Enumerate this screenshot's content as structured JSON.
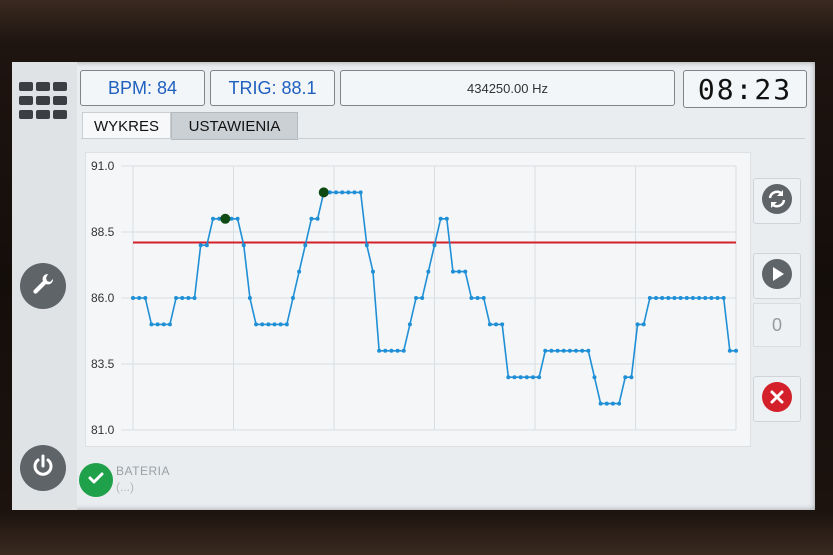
{
  "header": {
    "bpm": "BPM: 84",
    "trig": "TRIG: 88.1",
    "frequency": "434250.00 Hz",
    "time": "08:23"
  },
  "tabs": [
    {
      "label": "WYKRES",
      "active": true
    },
    {
      "label": "USTAWIENIA",
      "active": false
    }
  ],
  "right_panel": {
    "counter": "0"
  },
  "status": {
    "battery_label": "BATERIA",
    "battery_value": "(...)"
  },
  "icons": {
    "menu": "grid-menu-icon",
    "settings": "wrench-icon",
    "power": "power-icon",
    "refresh": "refresh-icon",
    "play": "play-icon",
    "close": "close-icon",
    "battery_ok": "check-icon"
  },
  "colors": {
    "line": "#1f8fd6",
    "trigger": "#d3202a",
    "peak_marker": "#0e4a12",
    "accent_text": "#1f5fbf",
    "ok": "#1fa04a",
    "close": "#d3202a"
  },
  "chart_data": {
    "type": "line",
    "ylim": [
      81.0,
      91.0
    ],
    "yticks": [
      "91.0",
      "88.5",
      "86.0",
      "83.5",
      "81.0"
    ],
    "grid": true,
    "threshold": 88.1,
    "x": [
      0,
      1,
      2,
      3,
      4,
      5,
      6,
      7,
      8,
      9,
      10,
      11,
      12,
      13,
      14,
      15,
      16,
      17,
      18,
      19,
      20,
      21,
      22,
      23,
      24,
      25,
      26,
      27,
      28,
      29,
      30,
      31,
      32,
      33,
      34,
      35,
      36,
      37,
      38,
      39,
      40,
      41,
      42,
      43,
      44,
      45,
      46,
      47,
      48,
      49,
      50,
      51,
      52,
      53,
      54,
      55,
      56,
      57,
      58,
      59,
      60,
      61,
      62,
      63,
      64,
      65,
      66,
      67,
      68,
      69,
      70,
      71,
      72,
      73,
      74,
      75,
      76,
      77,
      78,
      79,
      80,
      81,
      82,
      83,
      84,
      85,
      86,
      87,
      88,
      89,
      90,
      91,
      92,
      93,
      94,
      95,
      96,
      97,
      98
    ],
    "values": [
      86,
      86,
      86,
      85,
      85,
      85,
      85,
      86,
      86,
      86,
      86,
      88,
      88,
      89,
      89,
      89,
      89,
      89,
      88,
      86,
      85,
      85,
      85,
      85,
      85,
      85,
      86,
      87,
      88,
      89,
      89,
      90,
      90,
      90,
      90,
      90,
      90,
      90,
      88,
      87,
      84,
      84,
      84,
      84,
      84,
      85,
      86,
      86,
      87,
      88,
      89,
      89,
      87,
      87,
      87,
      86,
      86,
      86,
      85,
      85,
      85,
      83,
      83,
      83,
      83,
      83,
      83,
      84,
      84,
      84,
      84,
      84,
      84,
      84,
      84,
      83,
      82,
      82,
      82,
      82,
      83,
      83,
      85,
      85,
      86,
      86,
      86,
      86,
      86,
      86,
      86,
      86,
      86,
      86,
      86,
      86,
      86,
      84,
      84
    ],
    "peak_markers": [
      {
        "x": 15,
        "y": 89
      },
      {
        "x": 31,
        "y": 90
      }
    ]
  }
}
